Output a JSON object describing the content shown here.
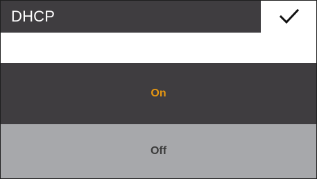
{
  "header": {
    "title": "DHCP"
  },
  "options": [
    {
      "label": "On",
      "selected": true
    },
    {
      "label": "Off",
      "selected": false
    }
  ],
  "icons": {
    "confirm": "checkmark-icon"
  },
  "colors": {
    "header_bg": "#3f3d40",
    "selected_bg": "#3f3d40",
    "selected_text": "#e69712",
    "unselected_bg": "#a7a8ab",
    "unselected_text": "#3a3a3a"
  }
}
